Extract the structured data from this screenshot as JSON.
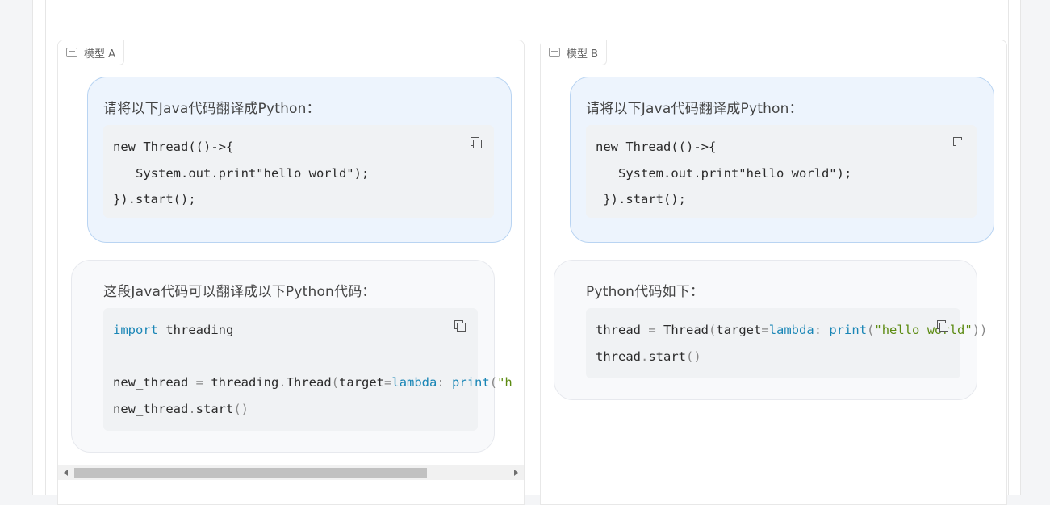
{
  "panels": [
    {
      "tab_label": "模型 A",
      "user_text": "请将以下Java代码翻译成Python：",
      "user_code": [
        "new Thread(()->{",
        "   System.out.print\"hello world\");",
        "}).start();"
      ],
      "assistant_text": "这段Java代码可以翻译成以下Python代码：",
      "assistant_code": [
        "import threading",
        "",
        "new_thread = threading.Thread(target=lambda: print(\"h",
        "new_thread.start()"
      ]
    },
    {
      "tab_label": "模型 B",
      "user_text": "请将以下Java代码翻译成Python：",
      "user_code": [
        "new Thread(()->{",
        "   System.out.print\"hello world\");",
        " }).start();"
      ],
      "assistant_text": "Python代码如下：",
      "assistant_code": [
        "thread = Thread(target=lambda: print(\"hello world\"))",
        "thread.start()"
      ]
    }
  ]
}
